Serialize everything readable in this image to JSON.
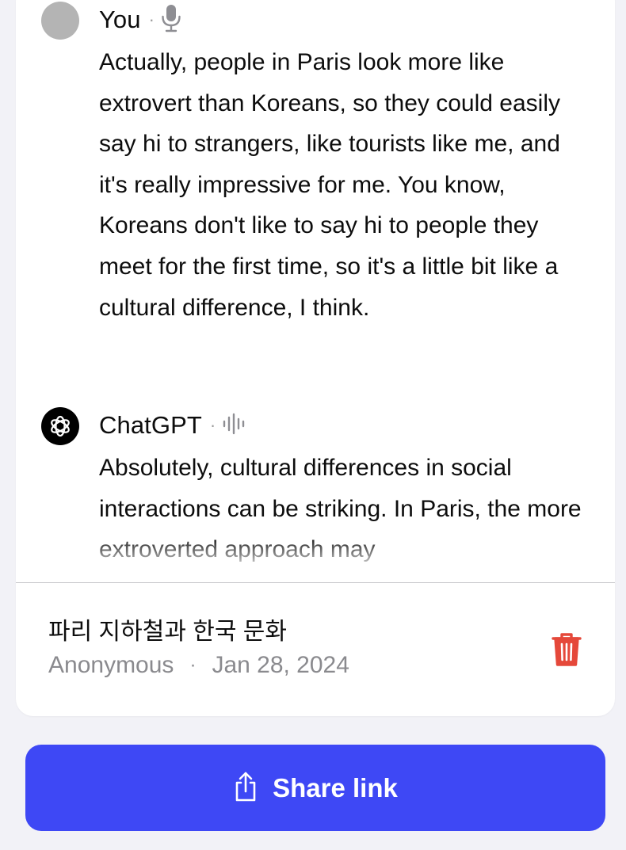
{
  "messages": [
    {
      "author": "You",
      "mode_icon": "microphone-icon",
      "text": "Actually, people in Paris look more like extrovert than Koreans, so they could easily say hi to strangers, like tourists like me, and it's really impressive for me. You know, Koreans don't like to say hi to people they meet for the first time, so it's a little bit like a cultural difference, I think."
    },
    {
      "author": "ChatGPT",
      "mode_icon": "audio-waveform-icon",
      "text": "Absolutely, cultural differences in social interactions can be striking. In Paris, the more extroverted approach may"
    }
  ],
  "conversation": {
    "title": "파리 지하철과 한국 문화",
    "owner": "Anonymous",
    "separator": "·",
    "date": "Jan 28, 2024"
  },
  "share_button": {
    "label": "Share link",
    "icon": "share-icon"
  },
  "colors": {
    "accent": "#3e48f5",
    "delete": "#e5483a",
    "background": "#f2f2f7"
  }
}
